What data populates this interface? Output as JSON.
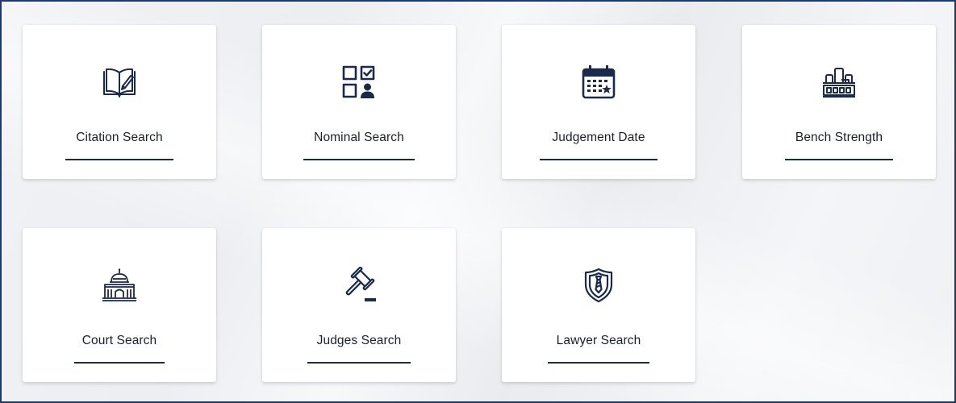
{
  "theme": {
    "accent": "#1b2a4a",
    "border": "#1f3a66"
  },
  "cards": [
    {
      "label": "Citation Search",
      "icon": "open-book-pencil-icon"
    },
    {
      "label": "Nominal Search",
      "icon": "checklist-user-icon"
    },
    {
      "label": "Judgement Date",
      "icon": "calendar-star-icon"
    },
    {
      "label": "Bench Strength",
      "icon": "bench-icon"
    },
    {
      "label": "Court Search",
      "icon": "courthouse-icon"
    },
    {
      "label": "Judges Search",
      "icon": "gavel-icon"
    },
    {
      "label": "Lawyer Search",
      "icon": "shield-tie-icon"
    }
  ]
}
